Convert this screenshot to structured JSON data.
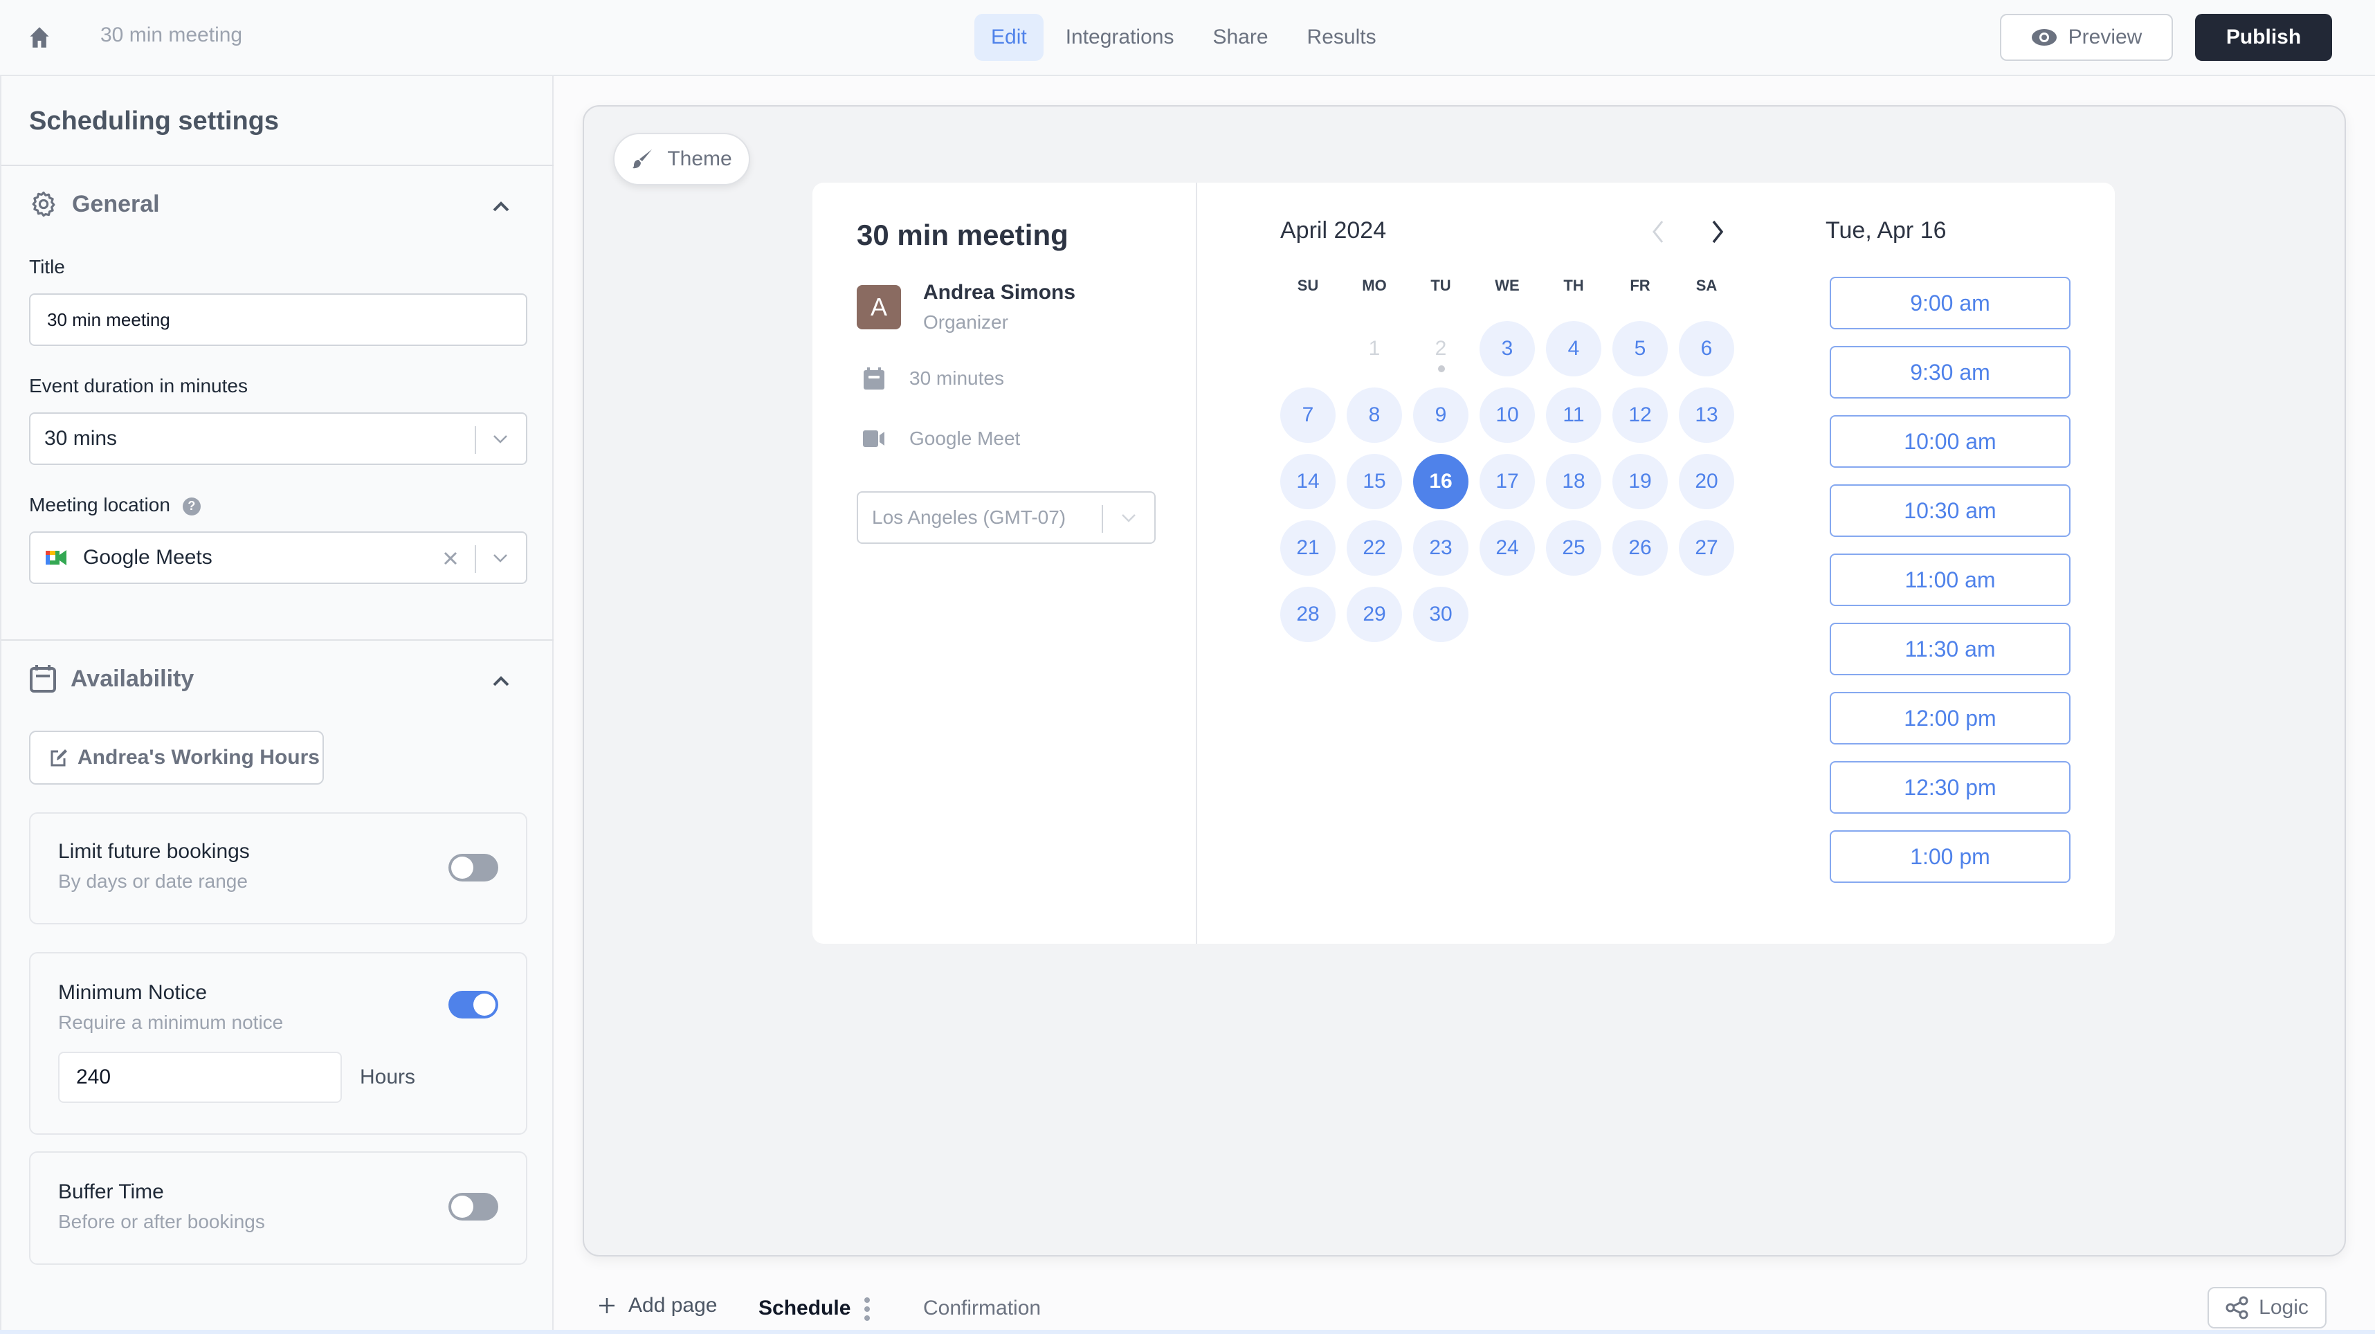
{
  "header": {
    "breadcrumb": "30 min meeting",
    "tabs": [
      {
        "label": "Edit",
        "active": true
      },
      {
        "label": "Integrations",
        "active": false
      },
      {
        "label": "Share",
        "active": false
      },
      {
        "label": "Results",
        "active": false
      }
    ],
    "preview_label": "Preview",
    "publish_label": "Publish"
  },
  "sidebar": {
    "title": "Scheduling settings",
    "general": {
      "heading": "General",
      "title_label": "Title",
      "title_value": "30 min meeting",
      "duration_label": "Event duration in minutes",
      "duration_value": "30 mins",
      "location_label": "Meeting location",
      "location_help": "?",
      "location_value": "Google Meets"
    },
    "availability": {
      "heading": "Availability",
      "working_hours_label": "Andrea's Working Hours",
      "limit_future": {
        "title": "Limit future bookings",
        "subtitle": "By days or date range",
        "enabled": false
      },
      "minimum_notice": {
        "title": "Minimum Notice",
        "subtitle": "Require a minimum notice",
        "enabled": true,
        "value": "240",
        "unit": "Hours"
      },
      "buffer_time": {
        "title": "Buffer Time",
        "subtitle": "Before or after bookings",
        "enabled": false
      }
    }
  },
  "canvas": {
    "theme_label": "Theme",
    "booking": {
      "title": "30 min meeting",
      "organizer_initial": "A",
      "organizer_name": "Andrea Simons",
      "organizer_role": "Organizer",
      "duration": "30 minutes",
      "location": "Google Meet",
      "timezone": "Los Angeles (GMT-07)"
    },
    "calendar": {
      "month_label": "April 2024",
      "weekdays": [
        "SU",
        "MO",
        "TU",
        "WE",
        "TH",
        "FR",
        "SA"
      ],
      "first_weekday_index": 1,
      "days_in_month": 30,
      "disabled_days": [
        1,
        2
      ],
      "today": 2,
      "selected_day": 16
    },
    "slots": {
      "date_label": "Tue, Apr 16",
      "times": [
        "9:00 am",
        "9:30 am",
        "10:00 am",
        "10:30 am",
        "11:00 am",
        "11:30 am",
        "12:00 pm",
        "12:30 pm",
        "1:00 pm"
      ]
    }
  },
  "pages": {
    "add_label": "Add page",
    "tabs": [
      {
        "label": "Schedule",
        "active": true
      },
      {
        "label": "Confirmation",
        "active": false
      }
    ],
    "logic_label": "Logic"
  },
  "colors": {
    "accent": "#4f82ea",
    "publish_bg": "#222836",
    "avatar_bg": "#8a6b61"
  }
}
